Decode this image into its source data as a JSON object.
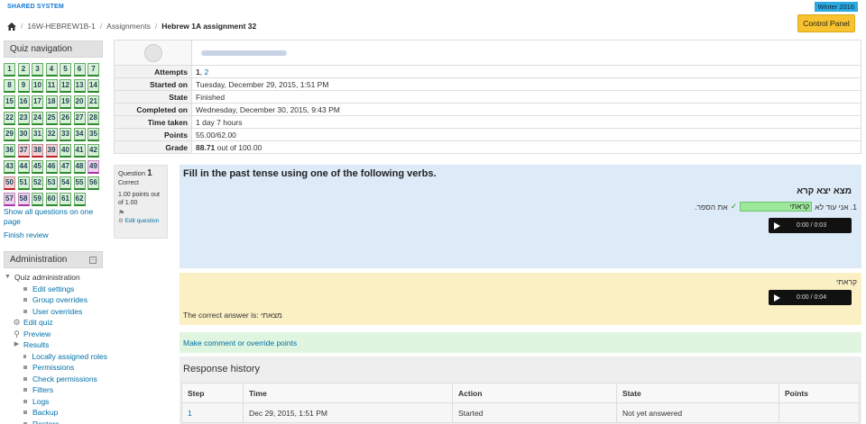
{
  "header": {
    "site_name": "SHARED SYSTEM",
    "term_badge": "Winter 2016",
    "control_panel": "Control Panel"
  },
  "breadcrumb": {
    "home_icon": "home-icon",
    "items": [
      "16W-HEBREW1B-1",
      "Assignments"
    ],
    "current": "Hebrew 1A assignment 32"
  },
  "quiz_nav": {
    "title": "Quiz navigation",
    "questions": [
      {
        "n": "1",
        "state": "correct"
      },
      {
        "n": "2",
        "state": "correct"
      },
      {
        "n": "3",
        "state": "correct"
      },
      {
        "n": "4",
        "state": "correct"
      },
      {
        "n": "5",
        "state": "correct"
      },
      {
        "n": "6",
        "state": "correct"
      },
      {
        "n": "7",
        "state": "correct"
      },
      {
        "n": "8",
        "state": "correct"
      },
      {
        "n": "9",
        "state": "correct"
      },
      {
        "n": "10",
        "state": "correct"
      },
      {
        "n": "11",
        "state": "correct"
      },
      {
        "n": "12",
        "state": "correct"
      },
      {
        "n": "13",
        "state": "correct"
      },
      {
        "n": "14",
        "state": "correct"
      },
      {
        "n": "15",
        "state": "correct"
      },
      {
        "n": "16",
        "state": "correct"
      },
      {
        "n": "17",
        "state": "correct"
      },
      {
        "n": "18",
        "state": "correct"
      },
      {
        "n": "19",
        "state": "correct"
      },
      {
        "n": "20",
        "state": "correct"
      },
      {
        "n": "21",
        "state": "correct"
      },
      {
        "n": "22",
        "state": "correct"
      },
      {
        "n": "23",
        "state": "correct"
      },
      {
        "n": "24",
        "state": "correct"
      },
      {
        "n": "25",
        "state": "correct"
      },
      {
        "n": "26",
        "state": "correct"
      },
      {
        "n": "27",
        "state": "correct"
      },
      {
        "n": "28",
        "state": "correct"
      },
      {
        "n": "29",
        "state": "correct"
      },
      {
        "n": "30",
        "state": "correct"
      },
      {
        "n": "31",
        "state": "correct"
      },
      {
        "n": "32",
        "state": "correct"
      },
      {
        "n": "33",
        "state": "correct"
      },
      {
        "n": "34",
        "state": "correct"
      },
      {
        "n": "35",
        "state": "correct"
      },
      {
        "n": "36",
        "state": "correct"
      },
      {
        "n": "37",
        "state": "incorrect"
      },
      {
        "n": "38",
        "state": "incorrect"
      },
      {
        "n": "39",
        "state": "incorrect"
      },
      {
        "n": "40",
        "state": "correct"
      },
      {
        "n": "41",
        "state": "correct"
      },
      {
        "n": "42",
        "state": "correct"
      },
      {
        "n": "43",
        "state": "correct"
      },
      {
        "n": "44",
        "state": "correct"
      },
      {
        "n": "45",
        "state": "correct"
      },
      {
        "n": "46",
        "state": "correct"
      },
      {
        "n": "47",
        "state": "correct"
      },
      {
        "n": "48",
        "state": "correct"
      },
      {
        "n": "49",
        "state": "partial"
      },
      {
        "n": "50",
        "state": "incorrect"
      },
      {
        "n": "51",
        "state": "correct"
      },
      {
        "n": "52",
        "state": "correct"
      },
      {
        "n": "53",
        "state": "correct"
      },
      {
        "n": "54",
        "state": "correct"
      },
      {
        "n": "55",
        "state": "correct"
      },
      {
        "n": "56",
        "state": "correct"
      },
      {
        "n": "57",
        "state": "partial"
      },
      {
        "n": "58",
        "state": "partial"
      },
      {
        "n": "59",
        "state": "correct"
      },
      {
        "n": "60",
        "state": "correct"
      },
      {
        "n": "61",
        "state": "correct"
      },
      {
        "n": "62",
        "state": "correct"
      }
    ],
    "show_all": "Show all questions on one page",
    "finish_review": "Finish review"
  },
  "administration": {
    "title": "Administration",
    "collapse_icon": "collapse-icon",
    "section": "Quiz administration",
    "items": [
      {
        "label": "Edit settings",
        "icon": "bullet"
      },
      {
        "label": "Group overrides",
        "icon": "bullet"
      },
      {
        "label": "User overrides",
        "icon": "bullet"
      },
      {
        "label": "Edit quiz",
        "icon": "gear-icon"
      },
      {
        "label": "Preview",
        "icon": "magnifier-icon"
      },
      {
        "label": "Results",
        "icon": "expand-arrow-icon"
      },
      {
        "label": "Locally assigned roles",
        "icon": "bullet"
      },
      {
        "label": "Permissions",
        "icon": "bullet"
      },
      {
        "label": "Check permissions",
        "icon": "bullet"
      },
      {
        "label": "Filters",
        "icon": "bullet"
      },
      {
        "label": "Logs",
        "icon": "bullet"
      },
      {
        "label": "Backup",
        "icon": "bullet"
      },
      {
        "label": "Restore",
        "icon": "bullet"
      }
    ]
  },
  "summary": {
    "rows": [
      {
        "label": "Attempts",
        "value_bold": "1",
        "value_sep": ", ",
        "value_link": "2"
      },
      {
        "label": "Started on",
        "value": "Tuesday, December 29, 2015, 1:51 PM"
      },
      {
        "label": "State",
        "value": "Finished"
      },
      {
        "label": "Completed on",
        "value": "Wednesday, December 30, 2015, 9:43 PM"
      },
      {
        "label": "Time taken",
        "value": "1 day 7 hours"
      },
      {
        "label": "Points",
        "value": "55.00/62.00"
      },
      {
        "label": "Grade",
        "value_bold": "88.71",
        "value_rest": " out of 100.00"
      }
    ]
  },
  "question_info": {
    "label": "Question",
    "number": "1",
    "status": "Correct",
    "points": "1.00 points out of 1.00",
    "flag_icon": "flag-icon",
    "edit": "Edit question"
  },
  "question": {
    "title": "Fill in the past tense using one of the following verbs.",
    "verbs": "מצא יצא קרא",
    "line_prefix": "1. אני עוד לא",
    "answer": "קראתי",
    "line_suffix": "את הספר.",
    "audio_time": "0:00  /  0:03"
  },
  "feedback": {
    "text": "קראתי",
    "audio_time": "0:00  /  0:04",
    "right_answer_prefix": "The correct answer is: ",
    "right_answer": "מצאתי"
  },
  "comment_link": "Make comment or override points",
  "history": {
    "title": "Response history",
    "columns": [
      "Step",
      "Time",
      "Action",
      "State",
      "Points"
    ],
    "rows": [
      [
        "1",
        "Dec 29, 2015, 1:51 PM",
        "Started",
        "Not yet answered",
        ""
      ]
    ]
  }
}
